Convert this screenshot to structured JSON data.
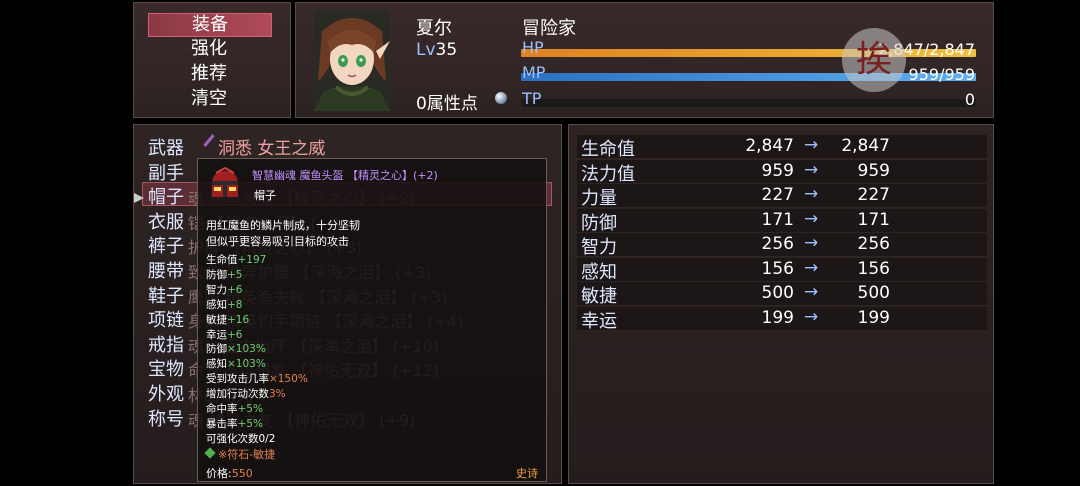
{
  "commands": [
    "装备",
    "强化",
    "推荐",
    "清空"
  ],
  "actor": {
    "name": "夏尔",
    "class": "冒险家",
    "level_label": "Lv",
    "level": "35",
    "points": "0属性点",
    "hp_label": "HP",
    "hp_text": "2,847/2,847",
    "mp_label": "MP",
    "mp_text": "959/959",
    "tp_label": "TP",
    "tp_text": "0",
    "hp_ratio": 1.0,
    "mp_ratio": 1.0,
    "tp_ratio": 0
  },
  "header_item": "洞悉 女王之威",
  "slots": [
    {
      "label": "武器",
      "item": ""
    },
    {
      "label": "副手",
      "item": ""
    },
    {
      "label": "帽子",
      "item": "魂 魔鱼头盔 【精灵之心】 (+2)"
    },
    {
      "label": "衣服",
      "item": "铠 【深海之泪】 (+4)"
    },
    {
      "label": "裤子",
      "item": "护裤 【精灵之心】 (+3)"
    },
    {
      "label": "腰带",
      "item": "致命 诡异护腰 【深海之泪】 (+3)"
    },
    {
      "label": "鞋子",
      "item": "鹰眼 精英渔夫靴 【深海之泪】 (+3)"
    },
    {
      "label": "项链",
      "item": "身法 精英钓手项链 【深海之泪】 (+4)"
    },
    {
      "label": "戒指",
      "item": "魂 ※远古指环 【深海之泪】 (+10)"
    },
    {
      "label": "宝物",
      "item": "命 ※不可想象 【神佑无双】 (+12)"
    },
    {
      "label": "外观",
      "item": "林的诅咒"
    },
    {
      "label": "称号",
      "item": "魂 神灵之友 【神佑无双】 (+9)"
    }
  ],
  "params": [
    {
      "name": "生命值",
      "cur": "2,847",
      "new": "2,847"
    },
    {
      "name": "法力值",
      "cur": "959",
      "new": "959"
    },
    {
      "name": "力量",
      "cur": "227",
      "new": "227"
    },
    {
      "name": "防御",
      "cur": "171",
      "new": "171"
    },
    {
      "name": "智力",
      "cur": "256",
      "new": "256"
    },
    {
      "name": "感知",
      "cur": "156",
      "new": "156"
    },
    {
      "name": "敏捷",
      "cur": "500",
      "new": "500"
    },
    {
      "name": "幸运",
      "cur": "199",
      "new": "199"
    }
  ],
  "arrow": "→",
  "tooltip": {
    "title": "智慧幽魂 魔鱼头盔 【精灵之心】(+2)",
    "type": "帽子",
    "desc1": "用红魔鱼的鳞片制成，十分坚韧",
    "desc2": "但似乎更容易吸引目标的攻击",
    "stats": [
      {
        "k": "生命值",
        "v": "+197"
      },
      {
        "k": "防御",
        "v": "+5"
      },
      {
        "k": "智力",
        "v": "+6"
      },
      {
        "k": "感知",
        "v": "+8"
      },
      {
        "k": "敏捷",
        "v": "+16"
      },
      {
        "k": "幸运",
        "v": "+6"
      },
      {
        "k": "防御",
        "v": "×103%"
      },
      {
        "k": "感知",
        "v": "×103%"
      },
      {
        "k": "受到攻击几率",
        "v": "×150%"
      },
      {
        "k": "增加行动次数",
        "v": "3%"
      },
      {
        "k": "命中率",
        "v": "+5%"
      },
      {
        "k": "暴击率",
        "v": "+5%"
      },
      {
        "k": "可强化次数",
        "v": "0/2"
      }
    ],
    "rune": "※符石-敏捷",
    "price_label": "价格:",
    "price": "550",
    "rarity": "史诗"
  },
  "badge": "挨",
  "colors": {
    "hp": "#f0a030",
    "mp": "#3a90d8",
    "accent": "#b04a58",
    "stat_green": "#70d070",
    "orange": "#e08050"
  }
}
